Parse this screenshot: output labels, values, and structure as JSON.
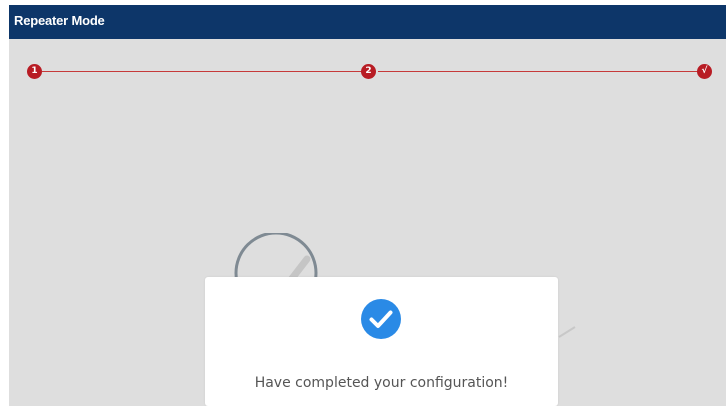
{
  "window": {
    "title": "Repeater Mode"
  },
  "steps": {
    "items": [
      {
        "label": "1",
        "state": "done"
      },
      {
        "label": "2",
        "state": "done"
      },
      {
        "label": "√",
        "state": "done"
      }
    ],
    "active_color": "#b81c24",
    "line_color": "#c63a3a"
  },
  "dialog": {
    "icon": "check-circle-icon",
    "message": "Have completed your configuration!",
    "accent_color": "#2a8ae6"
  },
  "colors": {
    "title_bar": "#0d3669",
    "page_background": "#dedede"
  }
}
